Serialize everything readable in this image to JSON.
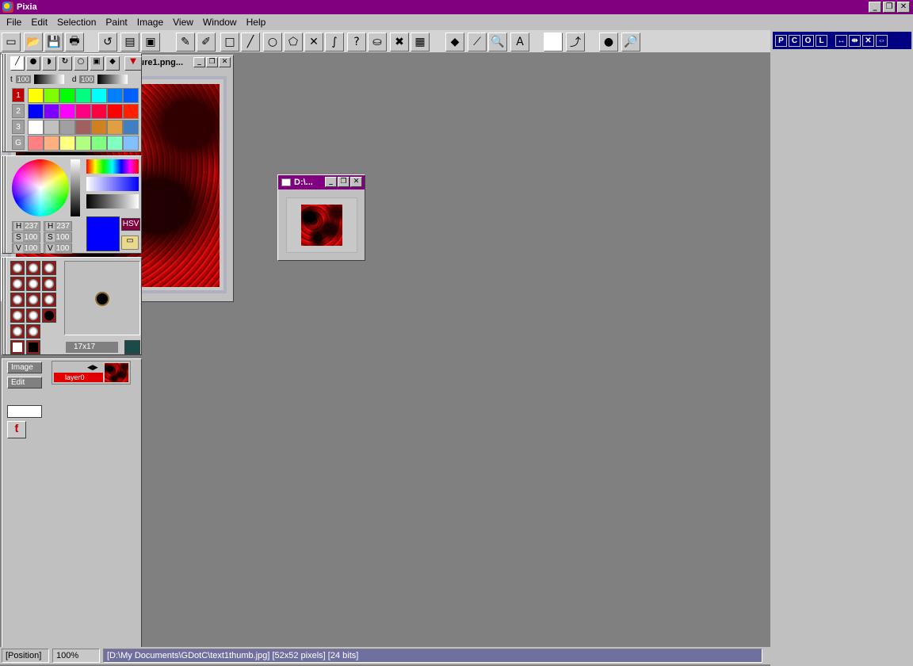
{
  "app": {
    "title": "Pixia"
  },
  "menu": [
    "File",
    "Edit",
    "Selection",
    "Paint",
    "Image",
    "View",
    "Window",
    "Help"
  ],
  "window_buttons": {
    "minimize": "_",
    "restore": "❐",
    "close": "✕"
  },
  "toolbar": {
    "icons": [
      "new-icon",
      "open-icon",
      "save-icon",
      "print-icon",
      "undo-icon",
      "copy-icon",
      "paste-icon",
      "pencil-icon",
      "eraser-icon",
      "rectangle-icon",
      "line-icon",
      "ellipse-icon",
      "polygon-icon",
      "cross-icon",
      "curve-icon",
      "lasso-icon",
      "fill-icon",
      "delete-selection-icon",
      "transparency-icon",
      "layer-icon",
      "eyedropper-icon",
      "zoom-icon",
      "text-icon",
      "color-swatch-icon",
      "import-icon",
      "color-mix-icon",
      "magnify-icon"
    ],
    "glyphs": [
      "▭",
      "📂",
      "💾",
      "🖶",
      "↺",
      "▤",
      "▣",
      "✎",
      "✐",
      "□",
      "╱",
      "○",
      "⬠",
      "✕",
      "∫",
      "?",
      "⛀",
      "✖",
      "▦",
      "◆",
      "⟋",
      "🔍",
      "A",
      "",
      "⤴",
      "●",
      "🔎"
    ]
  },
  "doc1": {
    "title": "D:\\My Documents\\GDotC\\texture1.png..."
  },
  "doc2": {
    "title": "D:\\..."
  },
  "panel": {
    "tabs": [
      "P",
      "C",
      "O",
      "L",
      "↔",
      "⇹",
      "✕",
      "⇔"
    ],
    "pen_values": {
      "t_label": "t",
      "t_value": "100",
      "d_label": "d",
      "d_value": "100"
    },
    "palette_rows": [
      {
        "label": "1",
        "colors": [
          "#ffff00",
          "#80ff00",
          "#00ff00",
          "#00ff80",
          "#00ffff",
          "#0080ff",
          "#0060ff"
        ]
      },
      {
        "label": "2",
        "colors": [
          "#0000ff",
          "#8000ff",
          "#ff00ff",
          "#ff0080",
          "#ff0040",
          "#ff0000",
          "#ff2000"
        ]
      },
      {
        "label": "3",
        "colors": [
          "#ffffff",
          "#c0c0c0",
          "#a0a0a0",
          "#a06060",
          "#d08020",
          "#e0a040",
          "#4080c0"
        ]
      },
      {
        "label": "G",
        "colors": [
          "#ff8080",
          "#ffb080",
          "#ffff80",
          "#b0ff80",
          "#80ff80",
          "#80ffc0",
          "#80c0ff"
        ]
      }
    ],
    "hsv": {
      "rows": [
        {
          "l1": "H",
          "v1": "237",
          "l2": "H",
          "v2": "237"
        },
        {
          "l1": "S",
          "v1": "100",
          "l2": "S",
          "v2": "100"
        },
        {
          "l1": "V",
          "v1": "100",
          "l2": "V",
          "v2": "100"
        }
      ],
      "mode": "HSV",
      "current_color": "#0000ff"
    },
    "brush_size": "17x17",
    "layer": {
      "image_btn": "Image",
      "edit_btn": "Edit",
      "layer_name": "layer0"
    }
  },
  "status": {
    "position": "[Position]",
    "zoom": "100%",
    "info": "[D:\\My Documents\\GDotC\\text1thumb.jpg] [52x52 pixels] [24 bits]"
  }
}
